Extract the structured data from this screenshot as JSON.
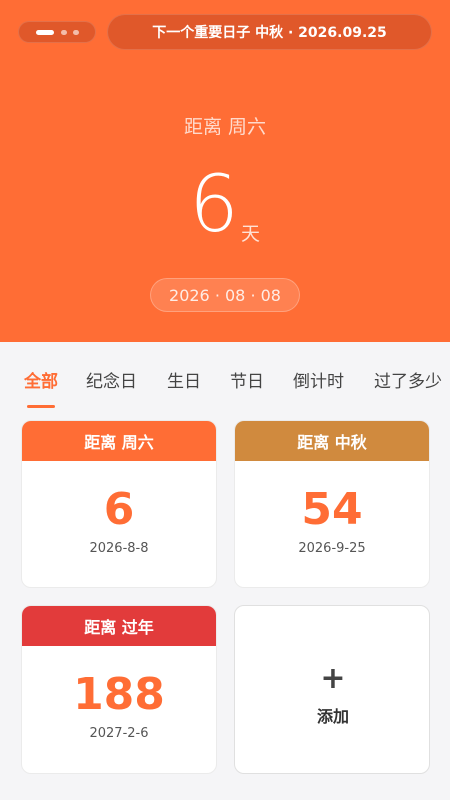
{
  "banner": {
    "text": "下一个重要日子  中秋 · 2026.09.25"
  },
  "hero": {
    "subtitle": "距离 周六",
    "count": "6",
    "unit": "天",
    "date": "2026 · 08 · 08",
    "color": "#ff6d35"
  },
  "tabs": [
    "全部",
    "纪念日",
    "生日",
    "节日",
    "倒计时",
    "过了多少"
  ],
  "cards": [
    {
      "title": "距离 周六",
      "count": "6",
      "date": "2026-8-8",
      "header_color": "#ff6d35"
    },
    {
      "title": "距离 中秋",
      "count": "54",
      "date": "2026-9-25",
      "header_color": "#d08a3e"
    },
    {
      "title": "距离 过年",
      "count": "188",
      "date": "2027-2-6",
      "header_color": "#e23b3b"
    }
  ],
  "add_card": {
    "icon": "plus-icon",
    "label": "添加"
  }
}
